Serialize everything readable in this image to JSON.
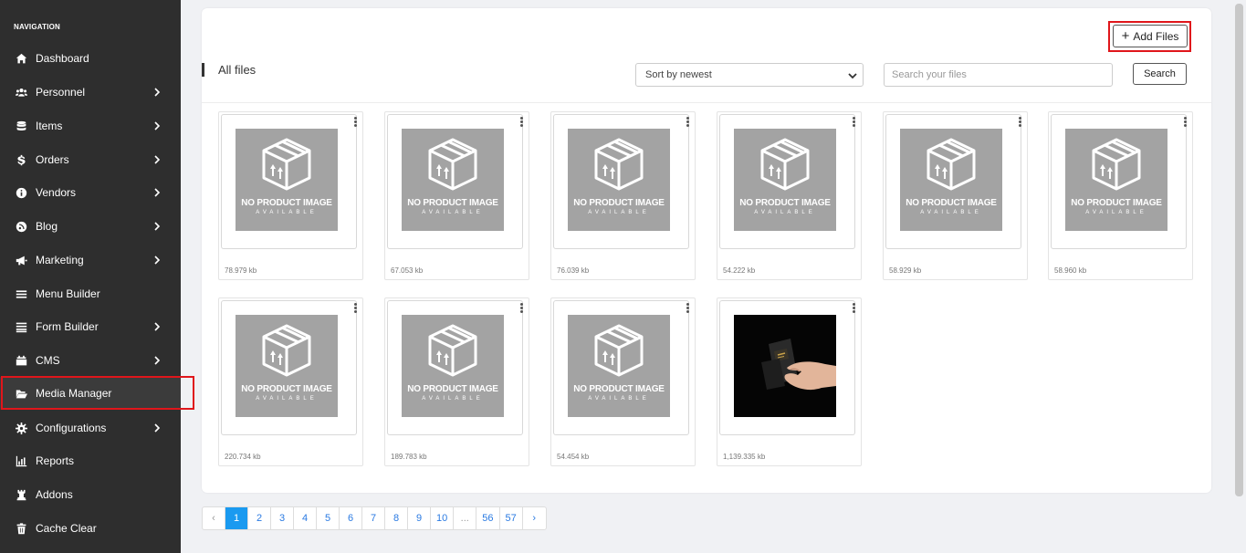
{
  "sidebar": {
    "heading": "NAVIGATION",
    "items": [
      {
        "label": "Dashboard",
        "icon": "home-icon",
        "chevron": false
      },
      {
        "label": "Personnel",
        "icon": "users-icon",
        "chevron": true
      },
      {
        "label": "Items",
        "icon": "database-icon",
        "chevron": true
      },
      {
        "label": "Orders",
        "icon": "dollar-icon",
        "chevron": true
      },
      {
        "label": "Vendors",
        "icon": "info-icon",
        "chevron": true
      },
      {
        "label": "Blog",
        "icon": "blog-icon",
        "chevron": true
      },
      {
        "label": "Marketing",
        "icon": "megaphone-icon",
        "chevron": true
      },
      {
        "label": "Menu Builder",
        "icon": "bars-icon",
        "chevron": false
      },
      {
        "label": "Form Builder",
        "icon": "list-icon",
        "chevron": true
      },
      {
        "label": "CMS",
        "icon": "cms-icon",
        "chevron": true
      },
      {
        "label": "Media Manager",
        "icon": "folder-open-icon",
        "chevron": false,
        "active": true
      },
      {
        "label": "Configurations",
        "icon": "gear-icon",
        "chevron": true
      },
      {
        "label": "Reports",
        "icon": "chart-icon",
        "chevron": false
      },
      {
        "label": "Addons",
        "icon": "chess-rook-icon",
        "chevron": false
      },
      {
        "label": "Cache Clear",
        "icon": "trash-icon",
        "chevron": false
      }
    ]
  },
  "toolbar": {
    "title": "All files",
    "add_label": "Add Files",
    "sort_value": "Sort by newest",
    "search_placeholder": "Search your files",
    "search_label": "Search"
  },
  "files": [
    {
      "size": "78.979 kb",
      "type": "placeholder"
    },
    {
      "size": "67.053 kb",
      "type": "placeholder"
    },
    {
      "size": "76.039 kb",
      "type": "placeholder"
    },
    {
      "size": "54.222 kb",
      "type": "placeholder"
    },
    {
      "size": "58.929 kb",
      "type": "placeholder"
    },
    {
      "size": "58.960 kb",
      "type": "placeholder"
    },
    {
      "size": "220.734 kb",
      "type": "placeholder"
    },
    {
      "size": "189.783 kb",
      "type": "placeholder"
    },
    {
      "size": "54.454 kb",
      "type": "placeholder"
    },
    {
      "size": "1,139.335 kb",
      "type": "photo"
    }
  ],
  "placeholder": {
    "line1": "NO PRODUCT IMAGE",
    "line2": "AVAILABLE"
  },
  "pagination": {
    "prev": "‹",
    "pages": [
      "1",
      "2",
      "3",
      "4",
      "5",
      "6",
      "7",
      "8",
      "9",
      "10",
      "...",
      "56",
      "57"
    ],
    "current": "1",
    "next": "›"
  },
  "colors": {
    "sidebar_bg": "#2e2e2e",
    "highlight": "#e0161b",
    "page_active": "#1a9af0",
    "placeholder_bg": "#a3a3a3"
  }
}
